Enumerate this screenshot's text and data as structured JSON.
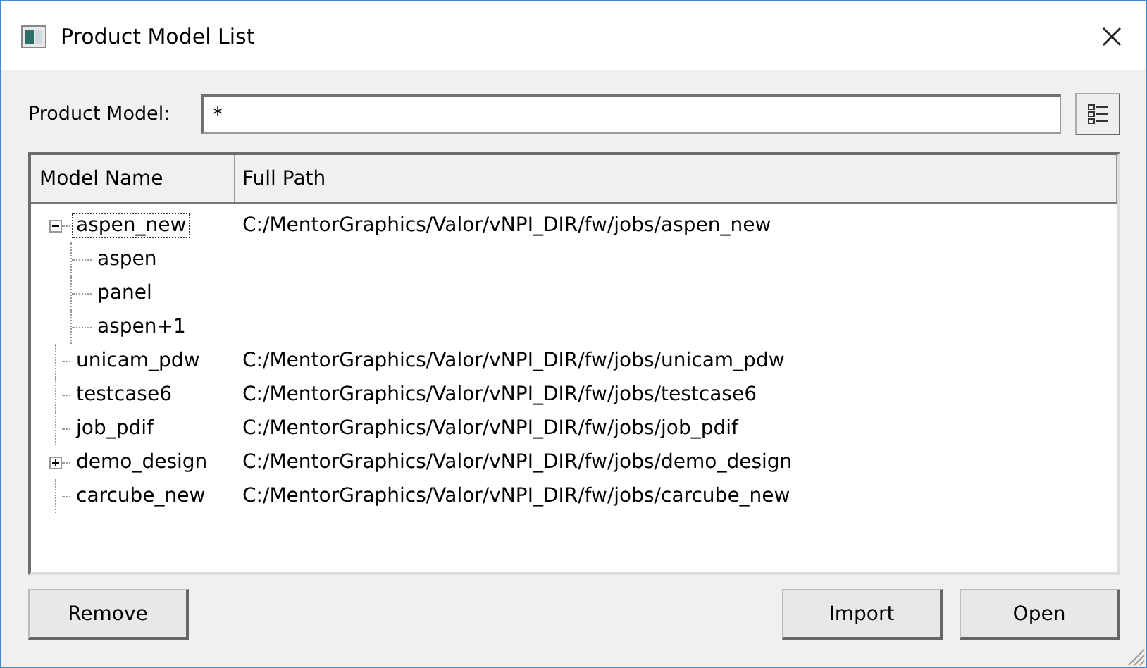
{
  "window": {
    "title": "Product Model List"
  },
  "filter": {
    "label": "Product Model:",
    "value": "*"
  },
  "table": {
    "columns": [
      "Model Name",
      "Full Path"
    ],
    "rows": [
      {
        "name": "aspen_new",
        "path": "C:/MentorGraphics/Valor/vNPI_DIR/fw/jobs/aspen_new",
        "selected": true,
        "expanded": true,
        "children": [
          {
            "name": "aspen",
            "selected": false
          },
          {
            "name": "panel",
            "selected": false
          },
          {
            "name": "aspen+1",
            "selected": false
          }
        ]
      },
      {
        "name": "unicam_pdw",
        "path": "C:/MentorGraphics/Valor/vNPI_DIR/fw/jobs/unicam_pdw",
        "selected": false
      },
      {
        "name": "testcase6",
        "path": "C:/MentorGraphics/Valor/vNPI_DIR/fw/jobs/testcase6",
        "selected": false
      },
      {
        "name": "job_pdif",
        "path": "C:/MentorGraphics/Valor/vNPI_DIR/fw/jobs/job_pdif",
        "selected": false
      },
      {
        "name": "demo_design",
        "path": "C:/MentorGraphics/Valor/vNPI_DIR/fw/jobs/demo_design",
        "selected": false,
        "expanded": false
      },
      {
        "name": "carcube_new",
        "path": "C:/MentorGraphics/Valor/vNPI_DIR/fw/jobs/carcube_new",
        "selected": false
      }
    ]
  },
  "buttons": {
    "left": [
      "Remove"
    ],
    "right": [
      "Import",
      "Open"
    ]
  }
}
